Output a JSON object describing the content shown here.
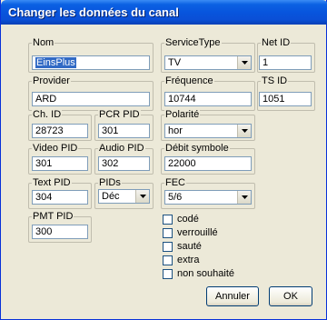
{
  "window": {
    "title": "Changer les données du canal"
  },
  "fields": {
    "nom": {
      "label": "Nom",
      "value": "EinsPlus"
    },
    "provider": {
      "label": "Provider",
      "value": "ARD"
    },
    "ch_id": {
      "label": "Ch. ID",
      "value": "28723"
    },
    "pcr_pid": {
      "label": "PCR PID",
      "value": "301"
    },
    "video_pid": {
      "label": "Video PID",
      "value": "301"
    },
    "audio_pid": {
      "label": "Audio PID",
      "value": "302"
    },
    "text_pid": {
      "label": "Text PID",
      "value": "304"
    },
    "pids": {
      "label": "PIDs",
      "value": "Déc"
    },
    "pmt_pid": {
      "label": "PMT PID",
      "value": "300"
    },
    "service_type": {
      "label": "ServiceType",
      "value": "TV"
    },
    "net_id": {
      "label": "Net ID",
      "value": "1"
    },
    "frequence": {
      "label": "Fréquence",
      "value": "10744"
    },
    "ts_id": {
      "label": "TS ID",
      "value": "1051"
    },
    "polarite": {
      "label": "Polarité",
      "value": "hor"
    },
    "debit_symbole": {
      "label": "Débit symbole",
      "value": "22000"
    },
    "fec": {
      "label": "FEC",
      "value": "5/6"
    }
  },
  "checkboxes": [
    {
      "label": "codé",
      "checked": false
    },
    {
      "label": "verrouillé",
      "checked": false
    },
    {
      "label": "sauté",
      "checked": false
    },
    {
      "label": "extra",
      "checked": false
    },
    {
      "label": "non souhaité",
      "checked": false
    }
  ],
  "buttons": {
    "cancel": "Annuler",
    "ok": "OK"
  }
}
